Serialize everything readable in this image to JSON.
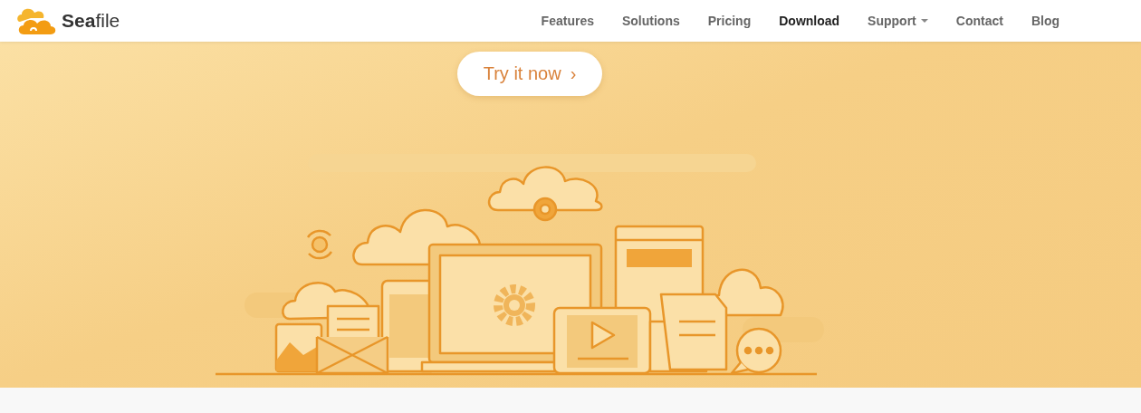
{
  "brand": {
    "prefix": "Sea",
    "suffix": "file"
  },
  "nav": [
    {
      "label": "Features",
      "selected": false,
      "dropdown": false
    },
    {
      "label": "Solutions",
      "selected": false,
      "dropdown": false
    },
    {
      "label": "Pricing",
      "selected": false,
      "dropdown": false
    },
    {
      "label": "Download",
      "selected": true,
      "dropdown": false
    },
    {
      "label": "Support",
      "selected": false,
      "dropdown": true
    },
    {
      "label": "Contact",
      "selected": false,
      "dropdown": false
    },
    {
      "label": "Blog",
      "selected": false,
      "dropdown": false
    }
  ],
  "hero": {
    "cta": "Try it now",
    "cta_arrow": "›"
  }
}
